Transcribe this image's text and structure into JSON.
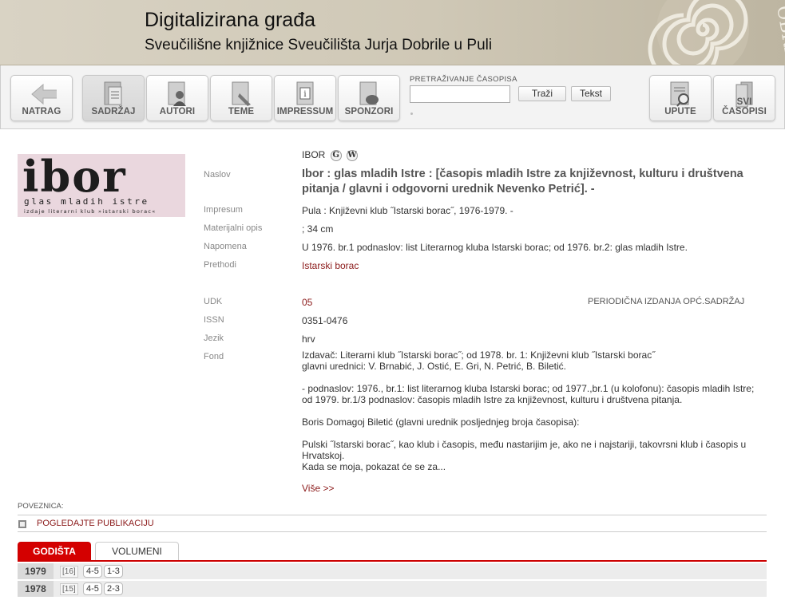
{
  "header": {
    "title": "Digitalizirana građa",
    "subtitle": "Sveučilišne knjižnice Sveučilišta Jurja Dobrile u Puli"
  },
  "toolbar": {
    "back": "NATRAG",
    "contents": "SADRŽAJ",
    "authors": "AUTORI",
    "topics": "TEME",
    "impressum": "IMPRESSUM",
    "sponsors": "SPONZORI",
    "search_label": "PRETRAŽIVANJE ČASOPISA",
    "search_placeholder": "",
    "search_button": "Traži",
    "text_button": "Tekst",
    "help": "UPUTE",
    "all_journals": "SVI ČASOPISI"
  },
  "cover": {
    "big": "ibor",
    "sub": "glas mladih istre",
    "sub2": "izdaje   literarni   klub   »istarski   borac«"
  },
  "record": {
    "short_title": "IBOR",
    "badge_g": "G",
    "badge_w": "W",
    "labels": {
      "title": "Naslov",
      "impressum": "Impresum",
      "material": "Materijalni opis",
      "note": "Napomena",
      "preceded": "Prethodi",
      "udk": "UDK",
      "issn": "ISSN",
      "language": "Jezik",
      "fond": "Fond"
    },
    "title": "Ibor : glas mladih Istre : [časopis mladih Istre za književnost, kulturu i društvena pitanja / glavni i odgovorni urednik Nevenko Petrić]. -",
    "impressum": "Pula : Književni klub ˝Istarski borac˝, 1976-1979. -",
    "material": "; 34 cm",
    "note": "U 1976. br.1 podnaslov: list Literarnog kluba Istarski borac; od 1976. br.2: glas mladih Istre.",
    "preceded": "Istarski borac",
    "udk": "05",
    "udk_desc": "PERIODIČNA IZDANJA OPĆ.SADRŽAJ",
    "issn": "0351-0476",
    "language": "hrv",
    "fond_p1_l1": "Izdavač: Literarni klub ˝Istarski borac˝; od 1978. br. 1: Književni klub ˝Istarski borac˝",
    "fond_p1_l2": "glavni urednici: V. Brnabić, J. Ostić, E. Gri, N. Petrić, B. Biletić.",
    "fond_p2_l1": "- podnaslov: 1976., br.1: list literarnog kluba Istarski borac; od 1977.,br.1 (u kolofonu): časopis mladih Istre;",
    "fond_p2_l2": "od 1979. br.1/3 podnaslov: časopis mladih Istre za književnost, kulturu i društvena pitanja.",
    "fond_p3": "Boris Domagoj Biletić (glavni urednik posljednjeg broja časopisa):",
    "fond_p4_l1": "Pulski ˝Istarski borac˝, kao klub i časopis, među nastarijim je, ako ne i najstariji, takovrsni klub i časopis u",
    "fond_p4_l2": "Hrvatskoj.",
    "fond_p4_l3": "Kada se moja, pokazat će se za...",
    "more": "Više >>"
  },
  "links": {
    "label": "POVEZNICA:",
    "view": "POGLEDAJTE PUBLIKACIJU"
  },
  "tabs": {
    "years": "GODIŠTA",
    "volumes": "VOLUMENI"
  },
  "years": [
    {
      "year": "1979",
      "count": "[16]",
      "vols": [
        "4-5",
        "1-3"
      ]
    },
    {
      "year": "1978",
      "count": "[15]",
      "vols": [
        "4-5",
        "2-3"
      ]
    }
  ]
}
